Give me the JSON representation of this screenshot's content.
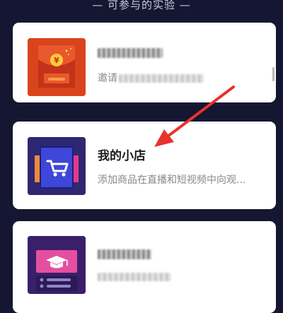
{
  "section": {
    "header": "— 可参与的实验 —"
  },
  "cards": [
    {
      "title_visible": "",
      "desc_prefix": "邀请",
      "icon": "red-envelope-icon",
      "color": "#d9441d"
    },
    {
      "title": "我的小店",
      "desc": "添加商品在直播和短视频中向观...",
      "icon": "shopping-cart-icon",
      "color": "#2f2771"
    },
    {
      "title_visible": "",
      "desc_prefix": "",
      "icon": "graduation-cap-icon",
      "color": "#3a1f6b"
    }
  ],
  "annotation": {
    "arrow_color": "#e8322e"
  }
}
